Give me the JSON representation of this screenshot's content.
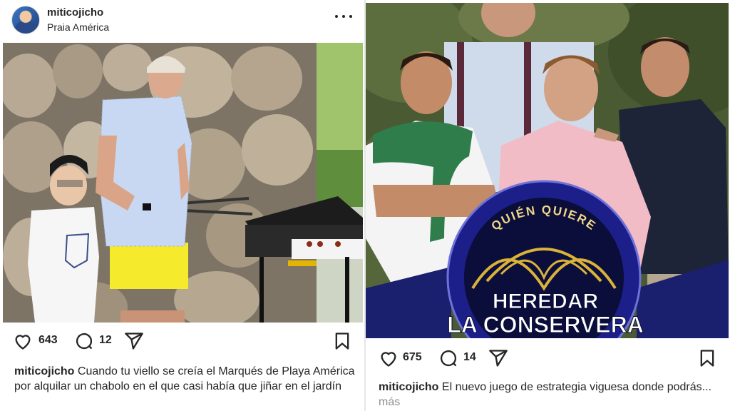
{
  "left_post": {
    "username": "miticojicho",
    "location": "Praia América",
    "likes": "643",
    "comments": "12",
    "caption_user": "miticojicho",
    "caption_text": "Cuando tu viello se creía el Marqués de Playa América por alquilar un chabolo en el que casi había que jiñar en el jardín"
  },
  "right_post": {
    "likes": "675",
    "comments": "14",
    "caption_user": "miticojicho",
    "caption_text": "El nuevo juego de estrategia viguesa donde podrás...",
    "more_label": "más",
    "overlay": {
      "top_arc": "QUIÉN QUIERE",
      "line1": "HEREDAR",
      "line2": "LA CONSERVERA"
    }
  },
  "icons": {
    "like": "heart-icon",
    "comment": "comment-icon",
    "share": "share-icon",
    "save": "bookmark-icon",
    "more": "more-icon"
  },
  "colors": {
    "text": "#262626",
    "muted": "#8e8e8e",
    "shorts": "#f5ea2b",
    "show_logo_blue": "#1c1f8a",
    "show_logo_gold": "#d9b23a"
  }
}
